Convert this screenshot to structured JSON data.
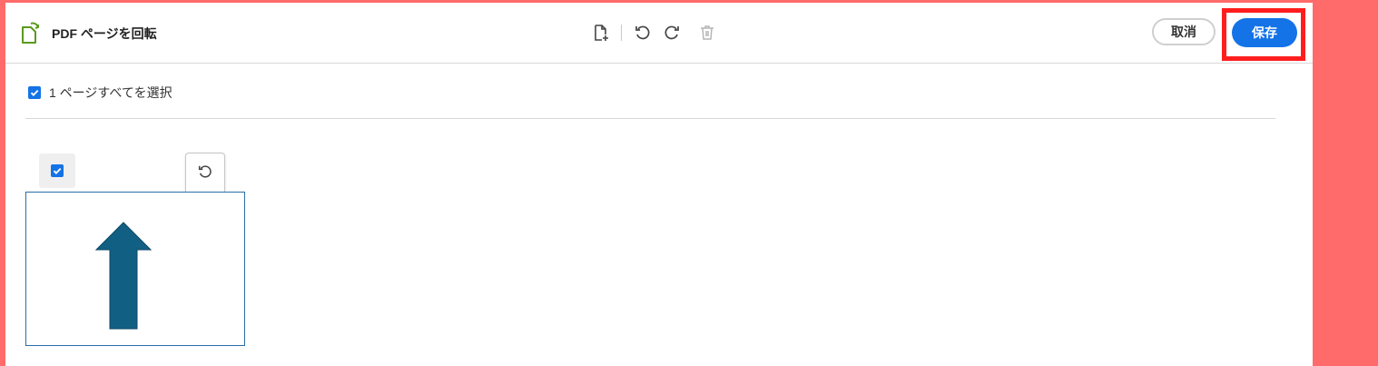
{
  "header": {
    "title": "PDF ページを回転",
    "app_icon": "rotate-page-icon",
    "toolbar": [
      {
        "name": "insert-page",
        "icon": "file-plus-icon"
      },
      {
        "name": "rotate-left",
        "icon": "rotate-ccw-icon"
      },
      {
        "name": "rotate-right",
        "icon": "rotate-cw-icon"
      },
      {
        "name": "delete",
        "icon": "trash-icon",
        "disabled": true
      }
    ],
    "cancel_label": "取消",
    "save_label": "保存"
  },
  "selection": {
    "select_all_label": "1 ページすべてを選択",
    "select_all_checked": true
  },
  "page": {
    "checked": true,
    "thumbnail": "up-arrow",
    "tools": [
      "rotate-ccw-icon",
      "rotate-cw-icon",
      "trash-icon"
    ]
  },
  "colors": {
    "accent": "#1473e6",
    "arrow": "#115f82",
    "background": "#ff6b6b",
    "highlight": "#ff1e1e",
    "app_icon": "#5a9a1e"
  }
}
